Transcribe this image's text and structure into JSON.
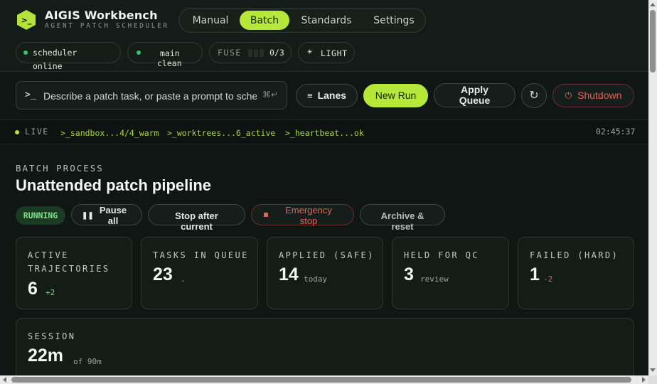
{
  "brand": {
    "logo_glyph": ">_",
    "title": "AIGIS Workbench",
    "subtitle": "AGENT PATCH SCHEDULER"
  },
  "nav": {
    "tabs": [
      {
        "label": "Manual",
        "active": false
      },
      {
        "label": "Batch",
        "active": true
      },
      {
        "label": "Standards",
        "active": false
      },
      {
        "label": "Settings",
        "active": false
      }
    ]
  },
  "status_pills": {
    "scheduler": {
      "label": "scheduler",
      "state": "online"
    },
    "branch": {
      "label": "main",
      "state": "clean"
    },
    "fuse": {
      "label": "FUSE",
      "value": "0/3"
    },
    "theme": {
      "icon": "sun-icon",
      "label": "LIGHT"
    }
  },
  "toolbar": {
    "prompt_glyph": ">_",
    "task_placeholder": "Describe a patch task, or paste a prompt to schedule",
    "task_value": "",
    "kbd_hint": "⌘↵",
    "lanes_label": "Lanes",
    "new_run_label": "New Run",
    "apply_queue_label": "Apply Queue",
    "shutdown_label": "Shutdown"
  },
  "activity": {
    "live_label": "LIVE",
    "entries": [
      ">_sandbox...4/4_warm",
      ">_worktrees...6_active",
      ">_heartbeat...ok"
    ],
    "clock": "02:45:37"
  },
  "batch": {
    "section_label": "BATCH PROCESS",
    "title": "Unattended patch pipeline",
    "status": "RUNNING",
    "controls": {
      "pause_all": "Pause all",
      "stop_after_current": "Stop after current",
      "emergency_stop": "Emergency stop",
      "archive_reset": "Archive & reset"
    }
  },
  "metrics": [
    {
      "label": "ACTIVE TRAJECTORIES",
      "value": "6",
      "sub": "+2",
      "sub_color": "#7fd67f"
    },
    {
      "label": "TASKS IN QUEUE",
      "value": "23",
      "sub": ".",
      "sub_color": "#9aa59f"
    },
    {
      "label": "APPLIED (SAFE)",
      "value": "14",
      "sub": "today",
      "sub_color": "#9aa59f"
    },
    {
      "label": "HELD FOR QC",
      "value": "3",
      "sub": "review",
      "sub_color": "#9aa59f"
    },
    {
      "label": "FAILED (HARD)",
      "value": "1",
      "sub": "-2",
      "sub_color": "#e2625a"
    }
  ],
  "session": {
    "label": "SESSION",
    "value": "22m",
    "sub": "of 90m"
  },
  "colors": {
    "accent": "#b6e83a",
    "danger": "#e2625a",
    "success": "#36c275",
    "background": "#0f1613"
  }
}
